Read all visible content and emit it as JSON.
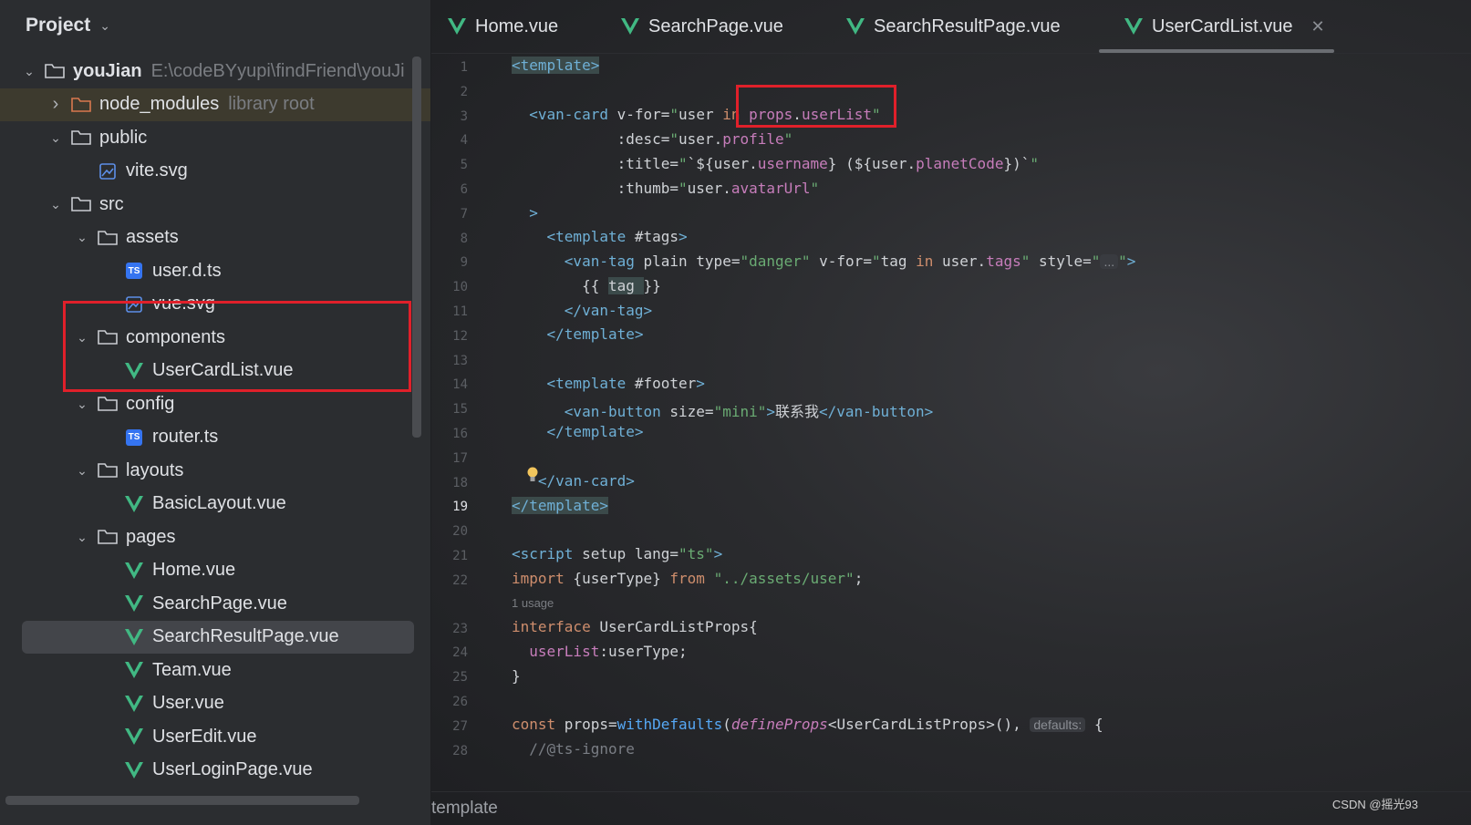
{
  "project": {
    "title": "Project"
  },
  "tree": [
    {
      "name": "youJian",
      "hint": "E:\\codeBYyupi\\findFriend\\youJi",
      "type": "folder",
      "level": 0,
      "expanded": true
    },
    {
      "name": "node_modules",
      "hint": "library root",
      "type": "folder-lib",
      "level": 1,
      "expanded": false
    },
    {
      "name": "public",
      "type": "folder",
      "level": 1,
      "expanded": true
    },
    {
      "name": "vite.svg",
      "type": "svg",
      "level": 2
    },
    {
      "name": "src",
      "type": "folder",
      "level": 1,
      "expanded": true
    },
    {
      "name": "assets",
      "type": "folder",
      "level": 2,
      "expanded": true
    },
    {
      "name": "user.d.ts",
      "type": "ts",
      "level": 3
    },
    {
      "name": "vue.svg",
      "type": "svg",
      "level": 3
    },
    {
      "name": "components",
      "type": "folder",
      "level": 2,
      "expanded": true
    },
    {
      "name": "UserCardList.vue",
      "type": "vue",
      "level": 3
    },
    {
      "name": "config",
      "type": "folder",
      "level": 2,
      "expanded": true
    },
    {
      "name": "router.ts",
      "type": "ts",
      "level": 3
    },
    {
      "name": "layouts",
      "type": "folder",
      "level": 2,
      "expanded": true
    },
    {
      "name": "BasicLayout.vue",
      "type": "vue",
      "level": 3
    },
    {
      "name": "pages",
      "type": "folder",
      "level": 2,
      "expanded": true
    },
    {
      "name": "Home.vue",
      "type": "vue",
      "level": 3
    },
    {
      "name": "SearchPage.vue",
      "type": "vue",
      "level": 3
    },
    {
      "name": "SearchResultPage.vue",
      "type": "vue",
      "level": 3,
      "selected": true
    },
    {
      "name": "Team.vue",
      "type": "vue",
      "level": 3
    },
    {
      "name": "User.vue",
      "type": "vue",
      "level": 3
    },
    {
      "name": "UserEdit.vue",
      "type": "vue",
      "level": 3
    },
    {
      "name": "UserLoginPage.vue",
      "type": "vue",
      "level": 3
    }
  ],
  "tabs": [
    {
      "label": "Home.vue"
    },
    {
      "label": "SearchPage.vue"
    },
    {
      "label": "SearchResultPage.vue"
    },
    {
      "label": "UserCardList.vue",
      "active": true
    }
  ],
  "editor": {
    "current_line": "19",
    "line_numbers": [
      "1",
      "2",
      "3",
      "4",
      "5",
      "6",
      "7",
      "8",
      "9",
      "10",
      "11",
      "12",
      "13",
      "14",
      "15",
      "16",
      "17",
      "18",
      "19",
      "20",
      "21",
      "22",
      "23",
      "24",
      "25",
      "26",
      "27",
      "28"
    ],
    "usage_hint": "1 usage",
    "inlay_defaults": "defaults:",
    "lines": [
      {
        "n": "1",
        "t": "<template>"
      },
      {
        "n": "3",
        "t": "  <van-card v-for=\"user in props.userList\""
      },
      {
        "n": "4",
        "t": ":desc=\"user.profile\""
      },
      {
        "n": "5",
        "t": ":title=\"`${user.username} (${user.planetCode})`\""
      },
      {
        "n": "6",
        "t": ":thumb=\"user.avatarUrl\""
      },
      {
        "n": "7",
        "t": ">"
      },
      {
        "n": "8",
        "t": "<template #tags>"
      },
      {
        "n": "9",
        "t": "<van-tag plain type=\"danger\" v-for=\"tag in user.tags\" style=\"...\">"
      },
      {
        "n": "10",
        "t": "{{ tag }}"
      },
      {
        "n": "11",
        "t": "</van-tag>"
      },
      {
        "n": "12",
        "t": "</template>"
      },
      {
        "n": "14",
        "t": "<template #footer>"
      },
      {
        "n": "15",
        "t": "<van-button size=\"mini\">联系我</van-button>"
      },
      {
        "n": "16",
        "t": "</template>"
      },
      {
        "n": "18",
        "t": "</van-card>"
      },
      {
        "n": "19",
        "t": "</template>"
      },
      {
        "n": "21",
        "t": "<script setup lang=\"ts\">"
      },
      {
        "n": "22",
        "t": "import {userType} from \"../assets/user\";"
      },
      {
        "n": "23",
        "t": "interface UserCardListProps{"
      },
      {
        "n": "24",
        "t": "userList:userType;"
      },
      {
        "n": "25",
        "t": "}"
      },
      {
        "n": "27",
        "t": "const props=withDefaults(defineProps<UserCardListProps>(), {"
      },
      {
        "n": "28",
        "t": "//@ts-ignore"
      }
    ]
  },
  "status": {
    "breadcrumb": "template"
  },
  "watermark": "CSDN @摇光93"
}
